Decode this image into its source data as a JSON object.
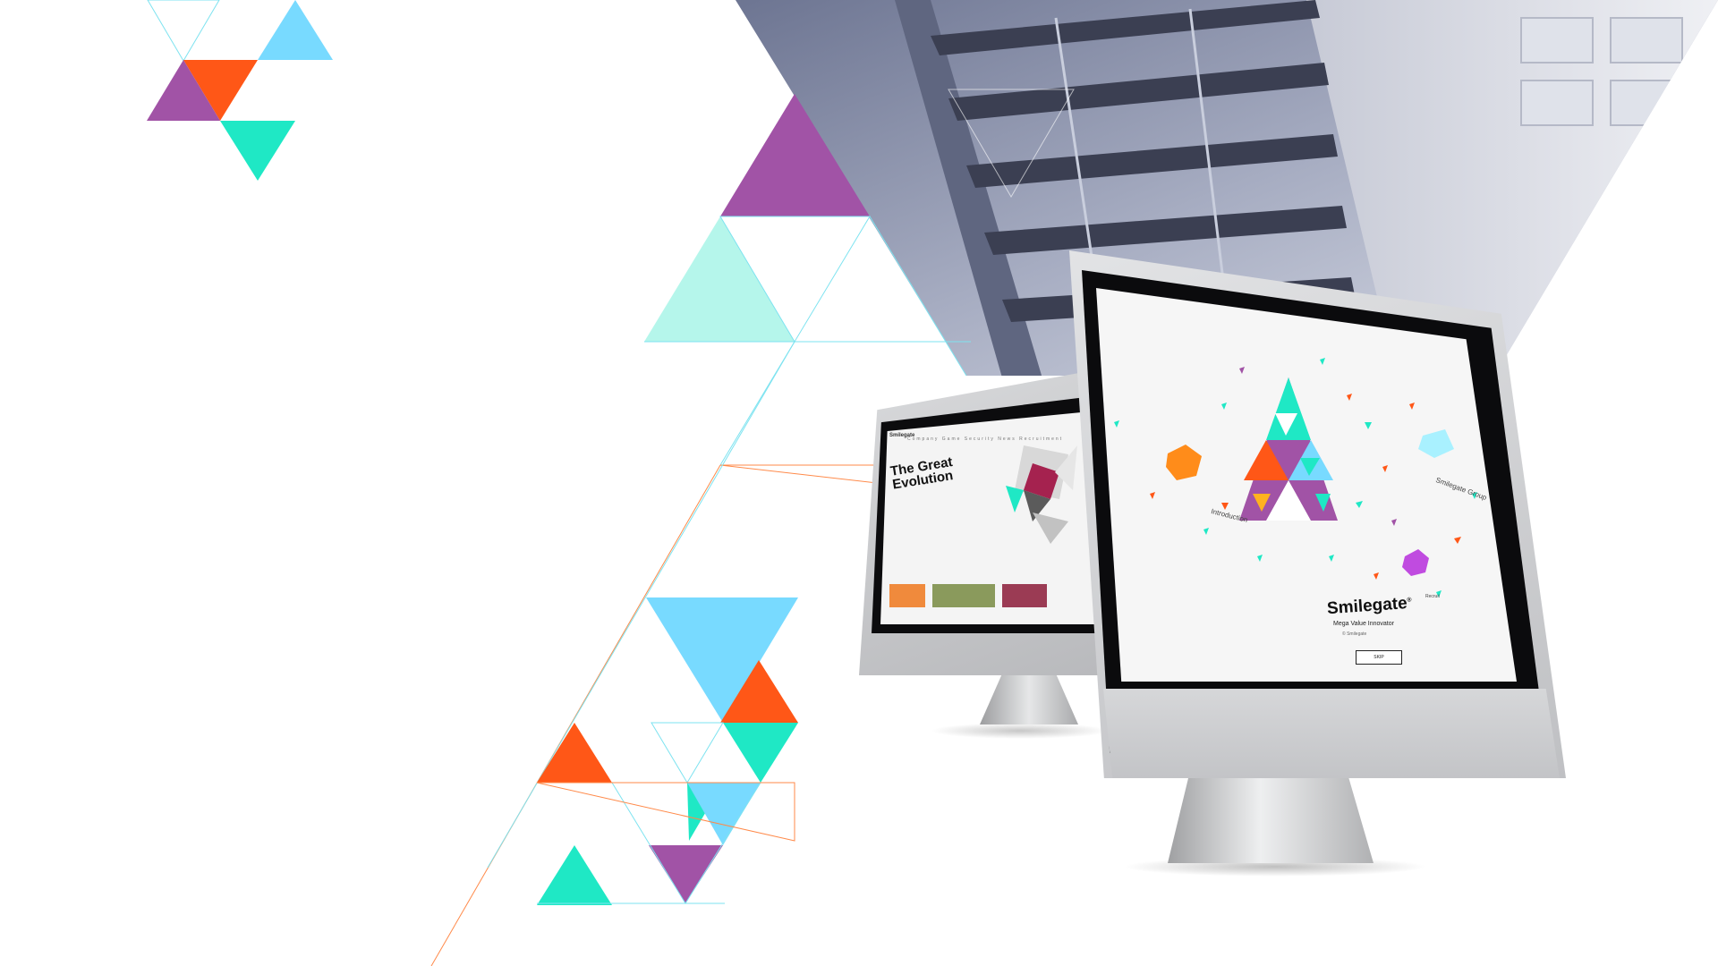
{
  "colors": {
    "purple": "#a153a6",
    "orange": "#ff5717",
    "sky": "#78daff",
    "mint": "#1fe8c5",
    "mint_light": "#b5f6eb",
    "line_cyan": "#7ee3f0",
    "line_orange": "#ff8a4a",
    "building": "#8c93ad"
  },
  "back_monitor": {
    "brand": "Smilegate",
    "nav": "Company   Game   Security   News   Recruitment",
    "headline": "The Great Evolution"
  },
  "front_monitor": {
    "brand": "Smilegate",
    "trademark": "®",
    "tagline": "Mega Value Innovator",
    "subline": "© Smilegate",
    "skip_label": "SKIP",
    "label_intro": "Introduction",
    "label_group": "Smilegate Group",
    "label_recruit": "Recruit"
  }
}
